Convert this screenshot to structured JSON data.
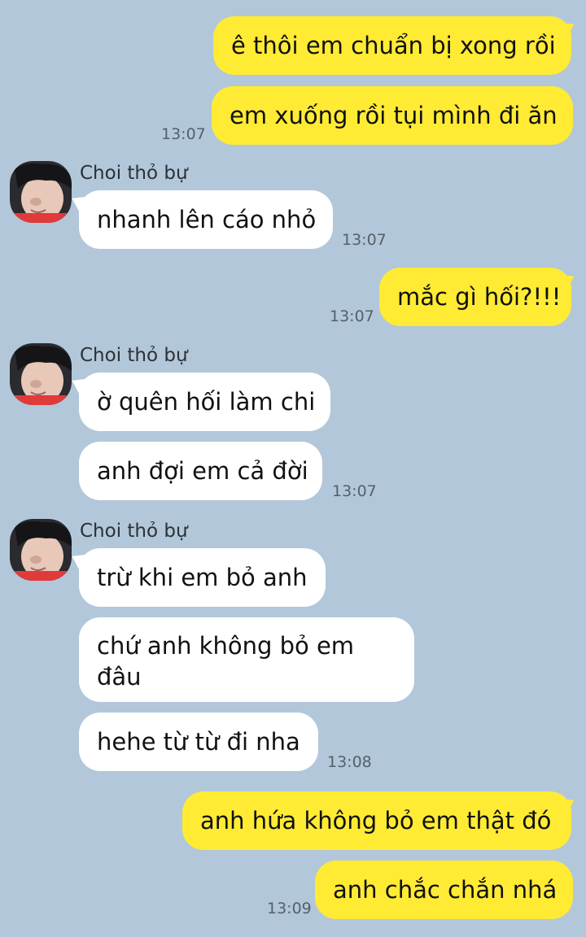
{
  "contact": {
    "name": "Choi thỏ bự",
    "avatar_icon": "profile-photo"
  },
  "messages": [
    {
      "from": "me",
      "text": "ê thôi em chuẩn bị xong rồi"
    },
    {
      "from": "me",
      "text": "em xuống rồi tụi mình đi ăn",
      "time": "13:07"
    },
    {
      "from": "them",
      "text": "nhanh lên cáo nhỏ",
      "time": "13:07"
    },
    {
      "from": "me",
      "text": "mắc gì hối?!!!",
      "time": "13:07"
    },
    {
      "from": "them",
      "text": "ờ quên hối làm chi"
    },
    {
      "from": "them",
      "text": "anh đợi em cả đời",
      "time": "13:07"
    },
    {
      "from": "them",
      "text": "trừ khi em bỏ anh"
    },
    {
      "from": "them",
      "text": "chứ anh không bỏ em đâu"
    },
    {
      "from": "them",
      "text": "hehe từ từ đi nha",
      "time": "13:08"
    },
    {
      "from": "me",
      "text": "anh hứa không bỏ em thật đó"
    },
    {
      "from": "me",
      "text": "anh chắc chắn nhá",
      "time": "13:09"
    }
  ],
  "colors": {
    "background": "#b2c7da",
    "my_bubble": "#ffeb34",
    "their_bubble": "#ffffff"
  }
}
